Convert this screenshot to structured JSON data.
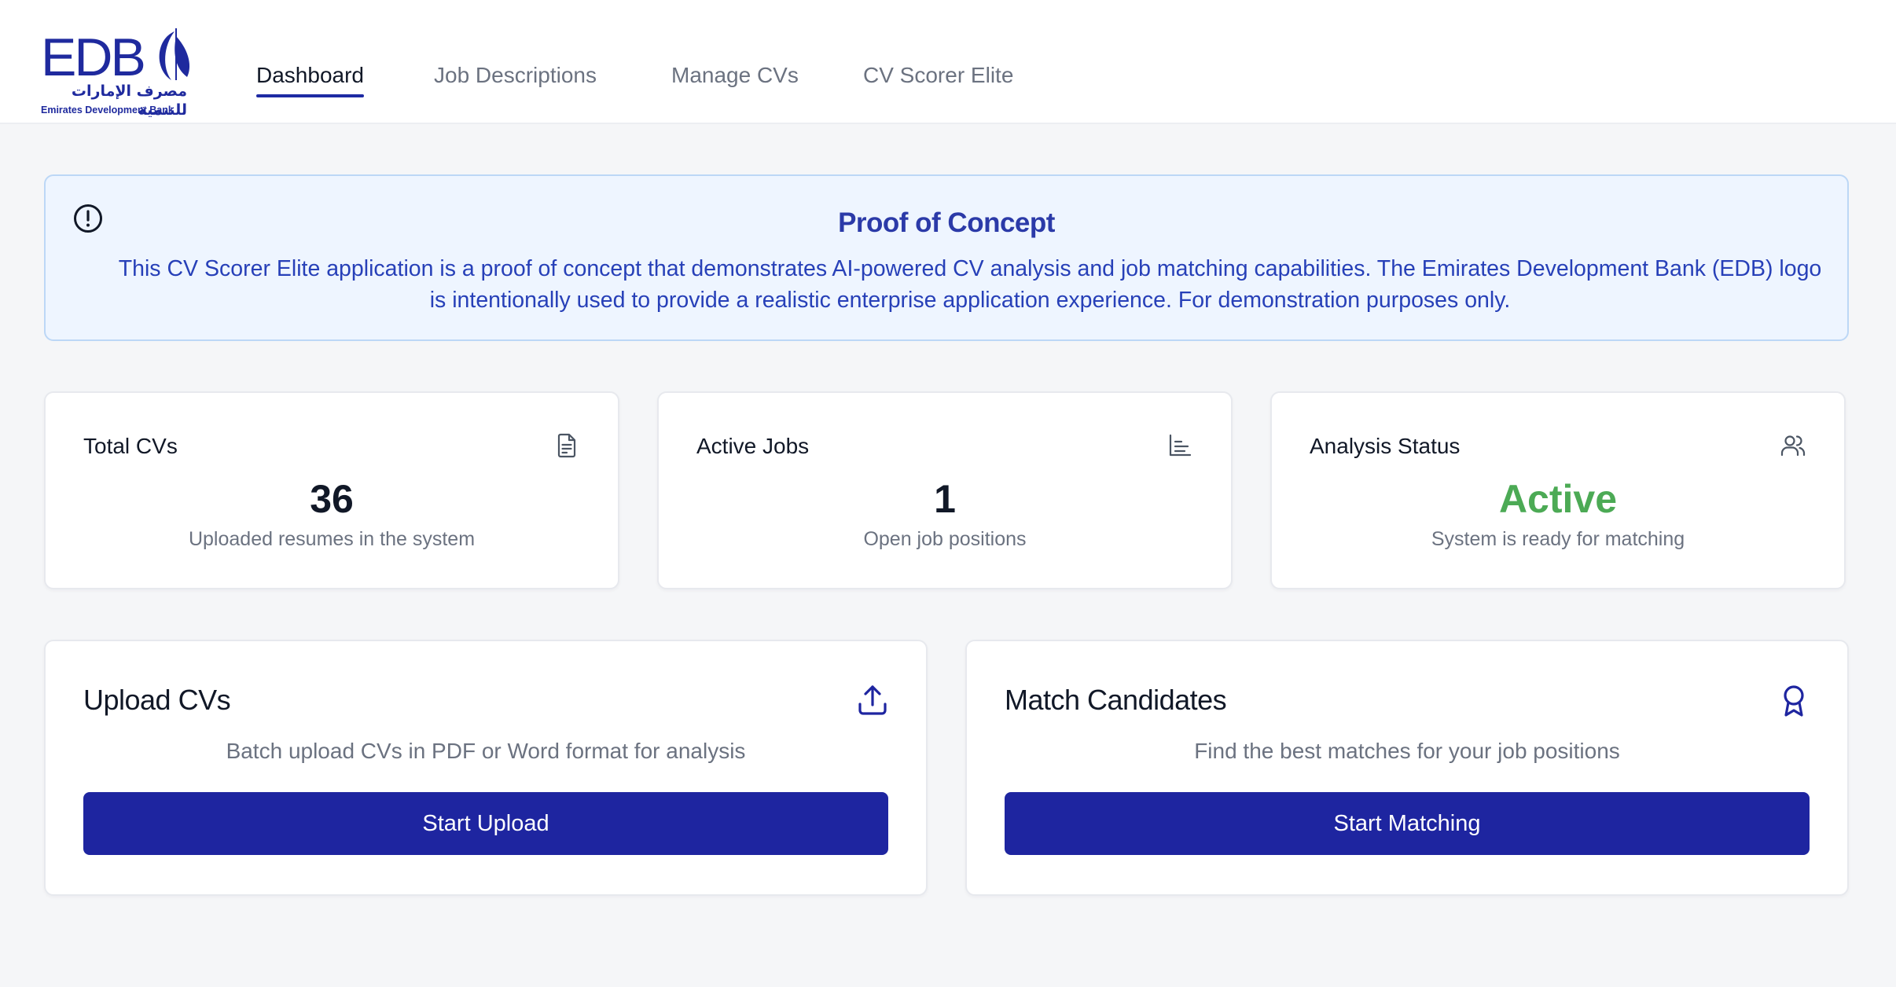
{
  "brand": {
    "logo_letters": "EDB",
    "logo_arabic": "مصرف الإمارات للتنمية",
    "logo_english": "Emirates Development Bank",
    "primary_color": "#1e25a0"
  },
  "nav": {
    "items": [
      {
        "label": "Dashboard",
        "active": true
      },
      {
        "label": "Job Descriptions",
        "active": false
      },
      {
        "label": "Manage CVs",
        "active": false
      },
      {
        "label": "CV Scorer Elite",
        "active": false
      }
    ]
  },
  "notice": {
    "icon": "alert-circle-icon",
    "title": "Proof of Concept",
    "body": "This CV Scorer Elite application is a proof of concept that demonstrates AI-powered CV analysis and job matching capabilities. The Emirates Development Bank (EDB) logo is intentionally used to provide a realistic enterprise application experience. For demonstration purposes only."
  },
  "stats": [
    {
      "title": "Total CVs",
      "value": "36",
      "desc": "Uploaded resumes in the system",
      "icon": "file-text-icon"
    },
    {
      "title": "Active Jobs",
      "value": "1",
      "desc": "Open job positions",
      "icon": "bar-chart-icon"
    },
    {
      "title": "Analysis Status",
      "value": "Active",
      "desc": "System is ready for matching",
      "icon": "users-icon",
      "value_color": "#4caa55"
    }
  ],
  "actions": [
    {
      "title": "Upload CVs",
      "desc": "Batch upload CVs in PDF or Word format for analysis",
      "button": "Start Upload",
      "icon": "upload-icon"
    },
    {
      "title": "Match Candidates",
      "desc": "Find the best matches for your job positions",
      "button": "Start Matching",
      "icon": "award-icon"
    }
  ]
}
